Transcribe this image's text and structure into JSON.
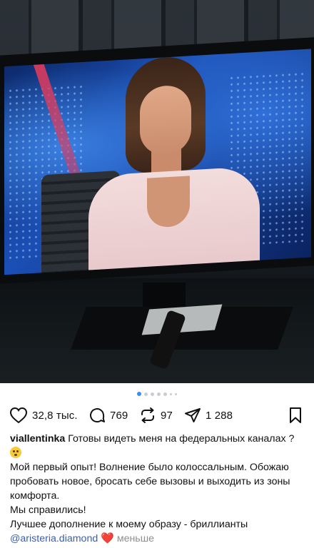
{
  "post": {
    "image_count": 7,
    "active_image": 1,
    "likes": "32,8 тыс.",
    "comments": "769",
    "reposts": "97",
    "shares": "1 288",
    "icons": {
      "like": "heart-icon",
      "comment": "comment-icon",
      "repost": "repost-icon",
      "share": "send-icon",
      "save": "bookmark-icon"
    },
    "colors": {
      "active_dot": "#3d8bf5",
      "mention": "#3d5fa8",
      "heart": "#e0242f"
    }
  },
  "caption": {
    "username": "viallentinka",
    "line1": "Готовы видеть меня на федеральных каналах ?",
    "line2": "Мой первый опыт! Волнение было колоссальным. Обожаю пробовать новое, бросать себе вызовы и выходить из зоны комфорта.",
    "line3": "Мы справились!",
    "line4": "Лучшее дополнение к моему образу - бриллианты",
    "mention": "@aristeria.diamond",
    "heart_emoji": "❤️",
    "less_label": "меньше"
  }
}
